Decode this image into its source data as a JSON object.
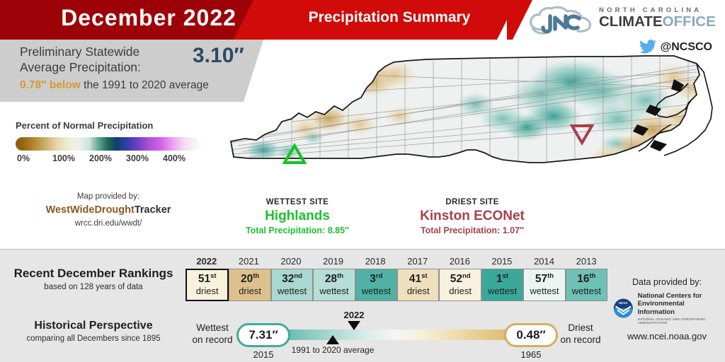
{
  "header": {
    "month_title": "December 2022",
    "summary_title": "Precipitation Summary",
    "banner_dark": "#9d0208",
    "banner_bright": "#d10a0a"
  },
  "logo": {
    "line_top": "NORTH CAROLINA",
    "climate": "CLIMATE",
    "office": "OFFICE",
    "twitter_handle": "@NCSCO",
    "twitter_color": "#55acee"
  },
  "stats": {
    "label_line1": "Preliminary Statewide",
    "label_line2": "Average Precipitation:",
    "value": "3.10″",
    "value_color": "#2e4a63",
    "departure": "0.78″ below",
    "departure_color": "#d39b30",
    "departure_rest": " the 1991 to 2020 average"
  },
  "legend": {
    "title": "Percent of Normal Precipitation",
    "ticks": [
      "0%",
      "100%",
      "200%",
      "300%",
      "400%"
    ]
  },
  "map_credit": {
    "line1": "Map provided by:",
    "brand_part1": "WestWideDrought",
    "brand_part2": "Tracker",
    "brand_color": "#8a5a1e",
    "url": "wrcc.dri.edu/wwdt/"
  },
  "sites": {
    "wettest": {
      "heading": "WETTEST SITE",
      "name": "Highlands",
      "total": "Total Precipitation: 8.85″",
      "color": "#1fc02e",
      "marker": "green-up-triangle"
    },
    "driest": {
      "heading": "DRIEST SITE",
      "name": "Kinston ECONet",
      "total": "Total Precipitation: 1.07″",
      "color": "#a8404a",
      "marker": "red-down-triangle"
    }
  },
  "rankings": {
    "title": "Recent December Rankings",
    "subtitle": "based on 128 years of data",
    "items": [
      {
        "year": "2022",
        "rank": "51",
        "suffix": "st",
        "word": "driest",
        "color": "#f7f1dd",
        "current": true
      },
      {
        "year": "2021",
        "rank": "20",
        "suffix": "th",
        "word": "driest",
        "color": "#ddc18c",
        "current": false
      },
      {
        "year": "2020",
        "rank": "32",
        "suffix": "nd",
        "word": "wettest",
        "color": "#a8d8d0",
        "current": false
      },
      {
        "year": "2019",
        "rank": "28",
        "suffix": "th",
        "word": "wettest",
        "color": "#b6ded6",
        "current": false
      },
      {
        "year": "2018",
        "rank": "3",
        "suffix": "rd",
        "word": "wettest",
        "color": "#4fb2a4",
        "current": false
      },
      {
        "year": "2017",
        "rank": "41",
        "suffix": "st",
        "word": "driest",
        "color": "#efe0bd",
        "current": false
      },
      {
        "year": "2016",
        "rank": "52",
        "suffix": "nd",
        "word": "driest",
        "color": "#f7f1dd",
        "current": false
      },
      {
        "year": "2015",
        "rank": "1",
        "suffix": "st",
        "word": "wettest",
        "color": "#3aa89a",
        "current": false
      },
      {
        "year": "2014",
        "rank": "57",
        "suffix": "th",
        "word": "wettest",
        "color": "#eaf5f2",
        "current": false
      },
      {
        "year": "2013",
        "rank": "16",
        "suffix": "th",
        "word": "wettest",
        "color": "#6fc1b5",
        "current": false
      }
    ]
  },
  "historical": {
    "title": "Historical Perspective",
    "subtitle": "comparing all Decembers since 1895",
    "wettest_label_l1": "Wettest",
    "wettest_label_l2": "on record",
    "wettest_value": "7.31″",
    "wettest_year": "2015",
    "driest_label_l1": "Driest",
    "driest_label_l2": "on record",
    "driest_value": "0.48″",
    "driest_year": "1965",
    "current_marker_label": "2022",
    "average_marker_label": "1991 to 2020 average",
    "wet_accent": "#3faa9e",
    "dry_accent": "#d4ae5c"
  },
  "noaa": {
    "heading": "Data provided by:",
    "name_line1": "National Centers for",
    "name_line2": "Environmental Information",
    "name_line3": "NATIONAL OCEANIC AND ATMOSPHERIC ADMINISTRATION",
    "url": "www.ncei.noaa.gov",
    "seal_color": "#1a3f7a"
  },
  "map": {
    "title": "North Carolina percent of normal precipitation map",
    "dry_color": "#ddbd82",
    "wet_color": "#2f9e90",
    "neutral_color": "#eef1f0"
  }
}
